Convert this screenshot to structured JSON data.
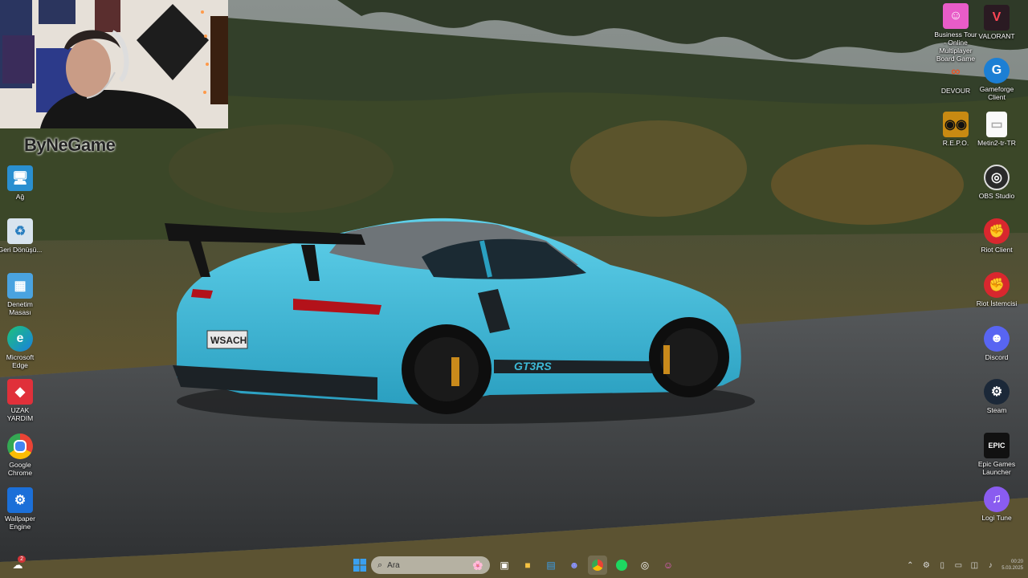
{
  "desktop_left": [
    {
      "label": "Ağ",
      "icon": "network-icon"
    },
    {
      "label": "Geri Dönüşü...",
      "icon": "recycle-bin-icon"
    },
    {
      "label": "Denetim Masası",
      "icon": "control-panel-icon"
    },
    {
      "label": "Microsoft Edge",
      "icon": "edge-icon"
    },
    {
      "label": "UZAK YARDIM",
      "icon": "remote-help-icon"
    },
    {
      "label": "Google Chrome",
      "icon": "chrome-icon"
    },
    {
      "label": "Wallpaper Engine",
      "icon": "wallpaper-engine-icon"
    }
  ],
  "desktop_right": [
    {
      "label": "Business Tour - Online Multiplayer Board Game",
      "icon": "business-tour-icon"
    },
    {
      "label": "VALORANT",
      "icon": "valorant-icon"
    },
    {
      "label": "DEVOUR",
      "icon": "devour-icon"
    },
    {
      "label": "Gameforge Client",
      "icon": "gameforge-icon"
    },
    {
      "label": "R.E.P.O.",
      "icon": "repo-icon"
    },
    {
      "label": "Metin2-tr-TR",
      "icon": "file-icon"
    },
    {
      "label": "OBS Studio",
      "icon": "obs-icon"
    },
    {
      "label": "Riot Client",
      "icon": "riot-client-icon"
    },
    {
      "label": "Riot İstemcisi",
      "icon": "riot-istemcisi-icon"
    },
    {
      "label": "Discord",
      "icon": "discord-icon"
    },
    {
      "label": "Steam",
      "icon": "steam-icon"
    },
    {
      "label": "Epic Games Launcher",
      "icon": "epic-games-icon"
    },
    {
      "label": "Logi Tune",
      "icon": "logi-tune-icon"
    }
  ],
  "watermark": "ByNeGame",
  "wallpaper": {
    "plate": "WSACH",
    "model_decal": "GT3RS"
  },
  "taskbar": {
    "search_placeholder": "Ara",
    "badge_count": "2",
    "clock_time": "00:20",
    "clock_date": "5.03.2025"
  },
  "colors": {
    "car": "#3db9d6",
    "accent": "#0078d4"
  }
}
